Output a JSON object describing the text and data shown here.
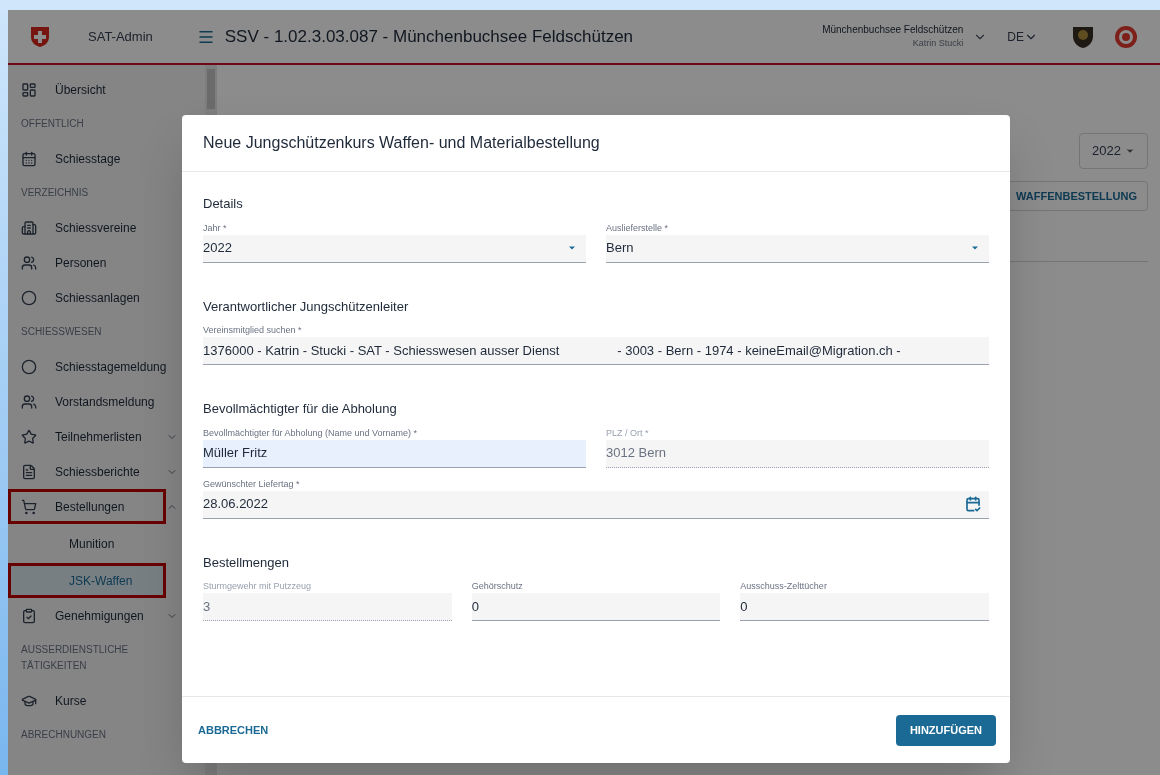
{
  "app": {
    "name": "SAT-Admin",
    "title": "SSV - 1.02.3.03.087 - Münchenbuchsee Feldschützen",
    "account": {
      "club": "Münchenbuchsee Feldschützen",
      "user": "Katrin Stucki"
    },
    "language": "DE"
  },
  "sidebar": {
    "entries": [
      {
        "kind": "item",
        "label": "Übersicht",
        "selected": false,
        "marked": false
      },
      {
        "kind": "section",
        "label": "OFFENTLICH"
      },
      {
        "kind": "item",
        "label": "Schiesstage",
        "selected": false,
        "marked": false
      },
      {
        "kind": "section",
        "label": "VERZEICHNIS"
      },
      {
        "kind": "item",
        "label": "Schiessvereine",
        "selected": false,
        "marked": false
      },
      {
        "kind": "item",
        "label": "Personen",
        "selected": false,
        "marked": false
      },
      {
        "kind": "item",
        "label": "Schiessanlagen",
        "selected": false,
        "marked": false
      },
      {
        "kind": "section",
        "label": "SCHIESSWESEN"
      },
      {
        "kind": "item",
        "label": "Schiesstagemeldung",
        "selected": false,
        "marked": false
      },
      {
        "kind": "item",
        "label": "Vorstandsmeldung",
        "selected": false,
        "marked": false
      },
      {
        "kind": "item",
        "label": "Teilnehmerlisten",
        "selected": false,
        "marked": false,
        "expanded": false
      },
      {
        "kind": "item",
        "label": "Schiessberichte",
        "selected": false,
        "marked": false,
        "expanded": false
      },
      {
        "kind": "item",
        "label": "Bestellungen",
        "selected": false,
        "marked": true,
        "expanded": true,
        "children": [
          {
            "label": "Munition",
            "selected": false,
            "marked": false
          },
          {
            "label": "JSK-Waffen",
            "selected": true,
            "marked": true
          }
        ]
      },
      {
        "kind": "item",
        "label": "Genehmigungen",
        "selected": false,
        "marked": false,
        "expanded": false
      },
      {
        "kind": "section",
        "label": "AUSSERDIENSTLICHE TÄTIGKEITEN"
      },
      {
        "kind": "item",
        "label": "Kurse",
        "selected": false,
        "marked": false
      },
      {
        "kind": "section",
        "label": "ABRECHNUNGEN"
      }
    ]
  },
  "page": {
    "year_select": "2022",
    "new_button": "WAFFENBESTELLUNG"
  },
  "dialog": {
    "title": "Neue Jungschützenkurs Waffen- und Materialbestellung",
    "sections": [
      {
        "heading": "Details",
        "rows": [
          [
            {
              "kind": "select",
              "label": "Jahr *",
              "value": "2022",
              "disabled": false,
              "focused": false
            },
            {
              "kind": "select",
              "label": "Auslieferstelle *",
              "value": "Bern",
              "disabled": false,
              "focused": false
            }
          ]
        ]
      },
      {
        "heading": "Verantwortlicher Jungschützenleiter",
        "rows": [
          [
            {
              "kind": "text",
              "label": "Vereinsmitglied suchen *",
              "value": "1376000 - Katrin - Stucki - SAT - Schiesswesen ausser Dienst                - 3003 - Bern - 1974 - keineEmail@Migration.ch -",
              "disabled": false,
              "focused": false
            }
          ]
        ]
      },
      {
        "heading": "Bevollmächtigter für die Abholung",
        "rows": [
          [
            {
              "kind": "text",
              "label": "Bevollmächtigter für Abholung (Name und Vorname) *",
              "value": "Müller Fritz",
              "disabled": false,
              "focused": true
            },
            {
              "kind": "text",
              "label": "PLZ / Ort *",
              "value": "3012 Bern",
              "disabled": true,
              "focused": false
            }
          ],
          [
            {
              "kind": "date",
              "label": "Gewünschter Liefertag *",
              "value": "28.06.2022",
              "disabled": false,
              "focused": false
            }
          ]
        ]
      },
      {
        "heading": "Bestellmengen",
        "rows": [
          [
            {
              "kind": "text",
              "label": "Sturmgewehr mit Putzzeug",
              "value": "3",
              "disabled": true,
              "focused": false
            },
            {
              "kind": "text",
              "label": "Gehörschutz",
              "value": "0",
              "disabled": false,
              "focused": false
            },
            {
              "kind": "text",
              "label": "Ausschuss-Zelttücher",
              "value": "0",
              "disabled": false,
              "focused": false
            }
          ]
        ]
      }
    ],
    "buttons": {
      "cancel": "ABBRECHEN",
      "submit": "HINZUFÜGEN"
    }
  }
}
